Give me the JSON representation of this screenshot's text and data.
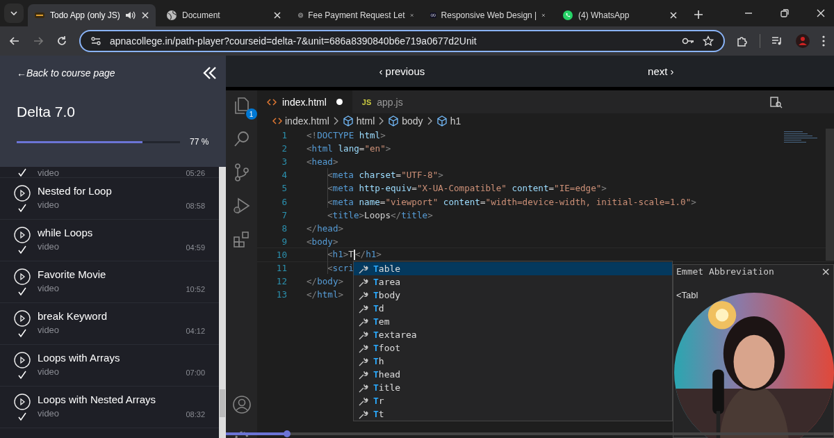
{
  "browser": {
    "tabs": [
      {
        "title": "Todo App (only JS)",
        "selected": true,
        "audio": true
      },
      {
        "title": "Document",
        "selected": false,
        "audio": false
      },
      {
        "title": "Fee Payment Request Let",
        "selected": false,
        "audio": false
      },
      {
        "title": "Responsive Web Design |",
        "selected": false,
        "audio": false
      },
      {
        "title": "(4) WhatsApp",
        "selected": false,
        "audio": false
      }
    ],
    "url": "apnacollege.in/path-player?courseid=delta-7&unit=686a8390840b6e719a0677d2Unit"
  },
  "sidebar": {
    "back_link": "←Back to course page",
    "course_title": "Delta 7.0",
    "progress": {
      "level": 0.77,
      "reading": "77 %"
    },
    "lessons": [
      {
        "type": "video",
        "duration": "05:26",
        "completed": true
      },
      {
        "title": "Nested for Loop",
        "type": "video",
        "duration": "08:58",
        "completed": true
      },
      {
        "title": "while Loops",
        "type": "video",
        "duration": "04:59",
        "completed": true
      },
      {
        "title": "Favorite Movie",
        "type": "video",
        "duration": "10:52",
        "completed": true
      },
      {
        "title": "break Keyword",
        "type": "video",
        "duration": "04:12",
        "completed": true
      },
      {
        "title": "Loops with Arrays",
        "type": "video",
        "duration": "07:00",
        "completed": true
      },
      {
        "title": "Loops with Nested Arrays",
        "type": "video",
        "duration": "08:32",
        "completed": true
      }
    ]
  },
  "nav": {
    "previous": "‹ previous",
    "next": "next ›"
  },
  "video": {
    "progress": {
      "level": 0.1
    },
    "editor": {
      "explorer_badge": "1",
      "tabs": [
        {
          "name": "index.html",
          "kind": "html",
          "modified": true,
          "selected": true
        },
        {
          "name": "app.js",
          "kind": "js",
          "icon_label": "JS",
          "modified": false,
          "selected": false
        }
      ],
      "breadcrumbs": [
        {
          "text": "index.html",
          "kind": "file"
        },
        {
          "text": "html",
          "kind": "element"
        },
        {
          "text": "body",
          "kind": "element"
        },
        {
          "text": "h1",
          "kind": "element"
        }
      ],
      "lines": [
        {
          "number": "1",
          "indented": false,
          "tokens": [
            {
              "kind": "punct",
              "text": "<!"
            },
            {
              "kind": "tag",
              "text": "DOCTYPE"
            },
            {
              "kind": "attr",
              "text": " html"
            },
            {
              "kind": "punct",
              "text": ">"
            }
          ]
        },
        {
          "number": "2",
          "indented": false,
          "tokens": [
            {
              "kind": "punct",
              "text": "<"
            },
            {
              "kind": "tag",
              "text": "html"
            },
            {
              "kind": "attr",
              "text": " lang"
            },
            {
              "kind": "text",
              "text": "="
            },
            {
              "kind": "string",
              "text": "\"en\""
            },
            {
              "kind": "punct",
              "text": ">"
            }
          ]
        },
        {
          "number": "3",
          "indented": false,
          "tokens": [
            {
              "kind": "punct",
              "text": "<"
            },
            {
              "kind": "tag",
              "text": "head"
            },
            {
              "kind": "punct",
              "text": ">"
            }
          ]
        },
        {
          "number": "4",
          "indented": true,
          "tokens": [
            {
              "kind": "punct",
              "text": "<"
            },
            {
              "kind": "tag",
              "text": "meta"
            },
            {
              "kind": "attr",
              "text": " charset"
            },
            {
              "kind": "text",
              "text": "="
            },
            {
              "kind": "string",
              "text": "\"UTF-8\""
            },
            {
              "kind": "punct",
              "text": ">"
            }
          ]
        },
        {
          "number": "5",
          "indented": true,
          "tokens": [
            {
              "kind": "punct",
              "text": "<"
            },
            {
              "kind": "tag",
              "text": "meta"
            },
            {
              "kind": "attr",
              "text": " http-equiv"
            },
            {
              "kind": "text",
              "text": "="
            },
            {
              "kind": "string",
              "text": "\"X-UA-Compatible\""
            },
            {
              "kind": "attr",
              "text": " content"
            },
            {
              "kind": "text",
              "text": "="
            },
            {
              "kind": "string",
              "text": "\"IE=edge\""
            },
            {
              "kind": "punct",
              "text": ">"
            }
          ]
        },
        {
          "number": "6",
          "indented": true,
          "tokens": [
            {
              "kind": "punct",
              "text": "<"
            },
            {
              "kind": "tag",
              "text": "meta"
            },
            {
              "kind": "attr",
              "text": " name"
            },
            {
              "kind": "text",
              "text": "="
            },
            {
              "kind": "string",
              "text": "\"viewport\""
            },
            {
              "kind": "attr",
              "text": " content"
            },
            {
              "kind": "text",
              "text": "="
            },
            {
              "kind": "string",
              "text": "\"width=device-width, initial-scale=1.0\""
            },
            {
              "kind": "punct",
              "text": ">"
            }
          ]
        },
        {
          "number": "7",
          "indented": true,
          "tokens": [
            {
              "kind": "punct",
              "text": "<"
            },
            {
              "kind": "tag",
              "text": "title"
            },
            {
              "kind": "punct",
              "text": ">"
            },
            {
              "kind": "text",
              "text": "Loops"
            },
            {
              "kind": "punct",
              "text": "</"
            },
            {
              "kind": "tag",
              "text": "title"
            },
            {
              "kind": "punct",
              "text": ">"
            }
          ]
        },
        {
          "number": "8",
          "indented": false,
          "tokens": [
            {
              "kind": "punct",
              "text": "</"
            },
            {
              "kind": "tag",
              "text": "head"
            },
            {
              "kind": "punct",
              "text": ">"
            }
          ]
        },
        {
          "number": "9",
          "indented": false,
          "tokens": [
            {
              "kind": "punct",
              "text": "<"
            },
            {
              "kind": "tag",
              "text": "body"
            },
            {
              "kind": "punct",
              "text": ">"
            }
          ]
        },
        {
          "number": "10",
          "indented": true,
          "tokens": [
            {
              "kind": "punct",
              "text": "<"
            },
            {
              "kind": "tag",
              "text": "h1"
            },
            {
              "kind": "punct",
              "text": ">"
            },
            {
              "kind": "text",
              "text": "T"
            },
            {
              "kind": "cursor"
            },
            {
              "kind": "punct",
              "text": "</"
            },
            {
              "kind": "tag",
              "text": "h1"
            },
            {
              "kind": "punct",
              "text": ">"
            }
          ]
        },
        {
          "number": "11",
          "indented": true,
          "tokens": [
            {
              "kind": "punct",
              "text": "<"
            },
            {
              "kind": "tag",
              "text": "scri"
            }
          ]
        },
        {
          "number": "12",
          "indented": false,
          "tokens": [
            {
              "kind": "punct",
              "text": "</"
            },
            {
              "kind": "tag",
              "text": "body"
            },
            {
              "kind": "punct",
              "text": ">"
            }
          ]
        },
        {
          "number": "13",
          "indented": false,
          "tokens": [
            {
              "kind": "punct",
              "text": "</"
            },
            {
              "kind": "tag",
              "text": "html"
            },
            {
              "kind": "punct",
              "text": ">"
            }
          ]
        }
      ],
      "suggestions": [
        {
          "match": "T",
          "rest": "able",
          "selected": true
        },
        {
          "match": "T",
          "rest": "area",
          "selected": false
        },
        {
          "match": "T",
          "rest": "body",
          "selected": false
        },
        {
          "match": "T",
          "rest": "d",
          "selected": false
        },
        {
          "match": "T",
          "rest": "em",
          "selected": false
        },
        {
          "match": "T",
          "rest": "extarea",
          "selected": false
        },
        {
          "match": "T",
          "rest": "foot",
          "selected": false
        },
        {
          "match": "T",
          "rest": "h",
          "selected": false
        },
        {
          "match": "T",
          "rest": "head",
          "selected": false
        },
        {
          "match": "T",
          "rest": "itle",
          "selected": false
        },
        {
          "match": "T",
          "rest": "r",
          "selected": false
        },
        {
          "match": "T",
          "rest": "t",
          "selected": false
        }
      ],
      "details": {
        "title": "Emmet Abbreviation",
        "close": "×",
        "preview": "<Tabl"
      }
    }
  }
}
